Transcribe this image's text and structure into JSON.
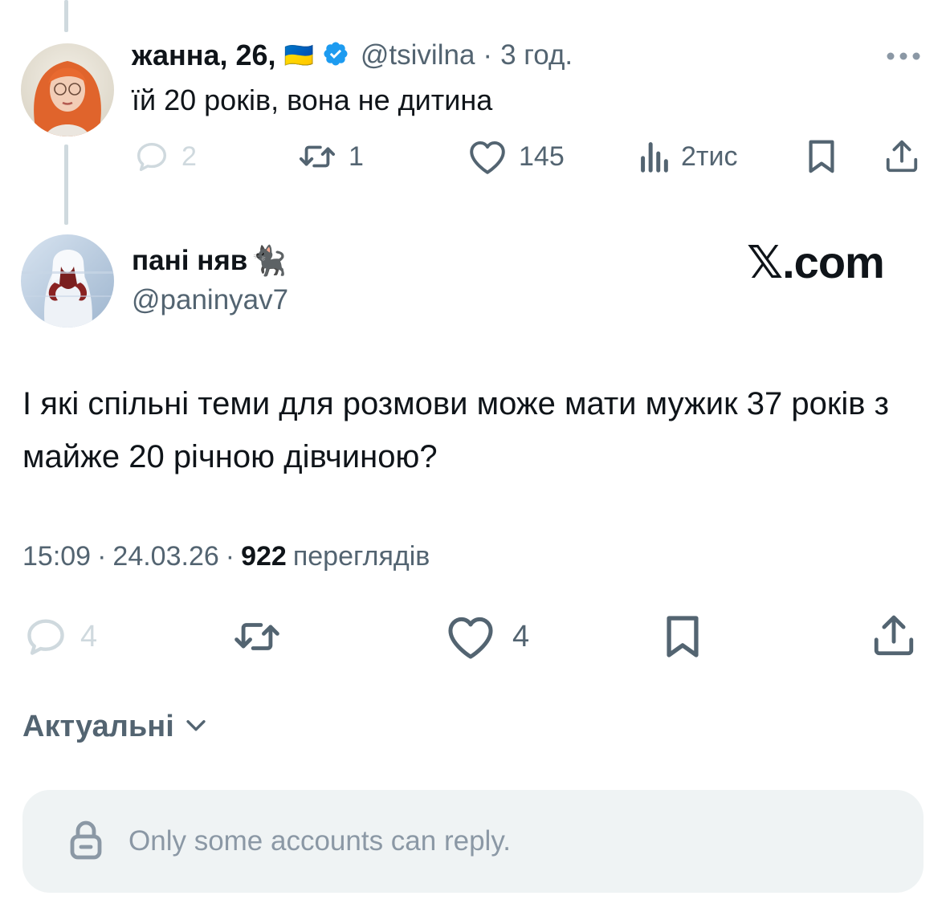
{
  "parent_tweet": {
    "name": "жанна, 26,",
    "flag": "🇺🇦",
    "handle": "@tsivilna",
    "separator": "·",
    "time": "3 год.",
    "text": "їй 20 років, вона не дитина",
    "actions": {
      "replies": "2",
      "retweets": "1",
      "likes": "145",
      "views": "2тис"
    }
  },
  "main_tweet": {
    "name": "пані няв",
    "name_emoji": "🐈‍⬛",
    "handle": "@paninyav7",
    "watermark": "𝕏.com",
    "text": "І які спільні теми для розмови може мати мужик 37 років з майже 20 річною дівчиною?",
    "time": "15:09",
    "date": "24.03.26",
    "sep1": "·",
    "sep2": "·",
    "views_count": "922",
    "views_label": "переглядів",
    "actions": {
      "replies": "4",
      "likes": "4"
    }
  },
  "sort": {
    "label": "Актуальні"
  },
  "reply_restriction": {
    "text": "Only some accounts can reply."
  },
  "colors": {
    "text": "#0f1419",
    "muted": "#536471",
    "faded": "#cfd9de",
    "verified": "#1d9bf0",
    "reply_bg": "#eff3f4"
  },
  "icons": [
    "reply-icon",
    "retweet-icon",
    "like-icon",
    "views-icon",
    "bookmark-icon",
    "share-icon",
    "verified-icon",
    "more-icon",
    "lock-icon",
    "chevron-down-icon"
  ]
}
